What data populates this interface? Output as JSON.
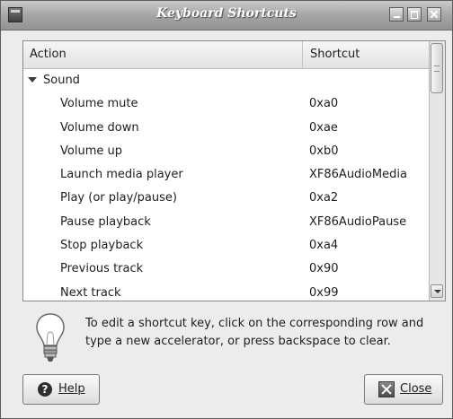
{
  "window": {
    "title": "Keyboard Shortcuts"
  },
  "table": {
    "columns": {
      "action": "Action",
      "shortcut": "Shortcut"
    },
    "group": {
      "label": "Sound",
      "expanded": true
    },
    "rows": [
      {
        "action": "Volume mute",
        "shortcut": "0xa0"
      },
      {
        "action": "Volume down",
        "shortcut": "0xae"
      },
      {
        "action": "Volume up",
        "shortcut": "0xb0"
      },
      {
        "action": "Launch media player",
        "shortcut": "XF86AudioMedia"
      },
      {
        "action": "Play (or play/pause)",
        "shortcut": "0xa2"
      },
      {
        "action": "Pause playback",
        "shortcut": "XF86AudioPause"
      },
      {
        "action": "Stop playback",
        "shortcut": "0xa4"
      },
      {
        "action": "Previous track",
        "shortcut": "0x90"
      },
      {
        "action": "Next track",
        "shortcut": "0x99"
      }
    ]
  },
  "hint": {
    "icon": "lightbulb-icon",
    "text": "To edit a shortcut key, click on the corresponding row and type a new accelerator, or press backspace to clear."
  },
  "buttons": {
    "help_label": "Help",
    "close_label": "Close"
  }
}
